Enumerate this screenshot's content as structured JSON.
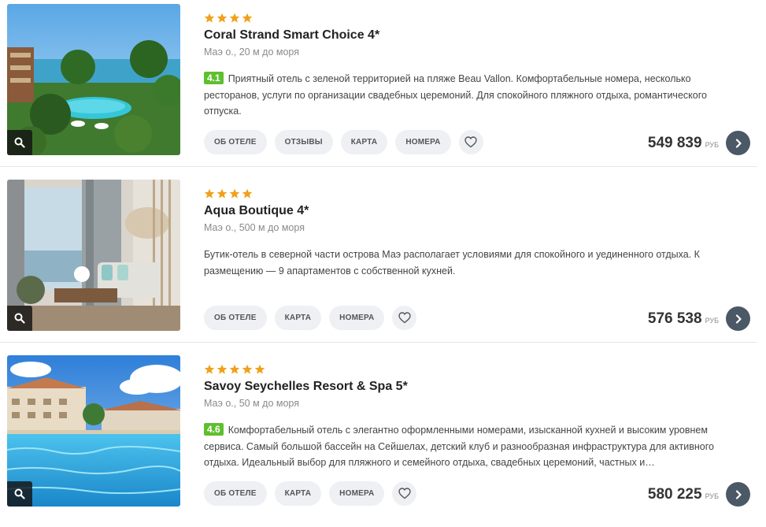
{
  "icons": {
    "zoom": "magnifier-icon",
    "favorite": "heart-icon",
    "go": "chevron-right-icon",
    "star": "star-icon"
  },
  "colors": {
    "star": "#f0a11b",
    "rating_bg": "#5fbf2e",
    "go_button": "#4b5866",
    "button_bg": "#eef0f3"
  },
  "hotels": [
    {
      "stars": 4,
      "title": "Coral Strand Smart Choice 4*",
      "location": "Маэ о., 20 м до моря",
      "rating": "4.1",
      "description": "Приятный отель с зеленой территорией на пляже Beau Vallon. Комфортабельные номера, несколько ресторанов, услуги по организации свадебных церемоний. Для спокойного пляжного отдыха, романтического отпуска.",
      "buttons": [
        "ОБ ОТЕЛЕ",
        "ОТЗЫВЫ",
        "КАРТА",
        "НОМЕРА"
      ],
      "price": "549 839",
      "currency": "РУБ"
    },
    {
      "stars": 4,
      "title": "Aqua Boutique 4*",
      "location": "Маэ о., 500 м до моря",
      "rating": null,
      "description": "Бутик-отель в северной части острова Маэ располагает условиями для спокойного и уединенного отдыха. К размещению — 9 апартаментов с собственной кухней.",
      "buttons": [
        "ОБ ОТЕЛЕ",
        "КАРТА",
        "НОМЕРА"
      ],
      "price": "576 538",
      "currency": "РУБ"
    },
    {
      "stars": 5,
      "title": "Savoy Seychelles Resort & Spa 5*",
      "location": "Маэ о., 50 м до моря",
      "rating": "4.6",
      "description": "Комфортабельный отель с элегантно оформленными номерами, изысканной кухней и высоким уровнем сервиса. Самый большой бассейн на Сейшелах, детский клуб и разнообразная инфраструктура для активного отдыха. Идеальный выбор для пляжного и семейного отдыха, свадебных церемоний, частных и…",
      "buttons": [
        "ОБ ОТЕЛЕ",
        "КАРТА",
        "НОМЕРА"
      ],
      "price": "580 225",
      "currency": "РУБ"
    }
  ]
}
